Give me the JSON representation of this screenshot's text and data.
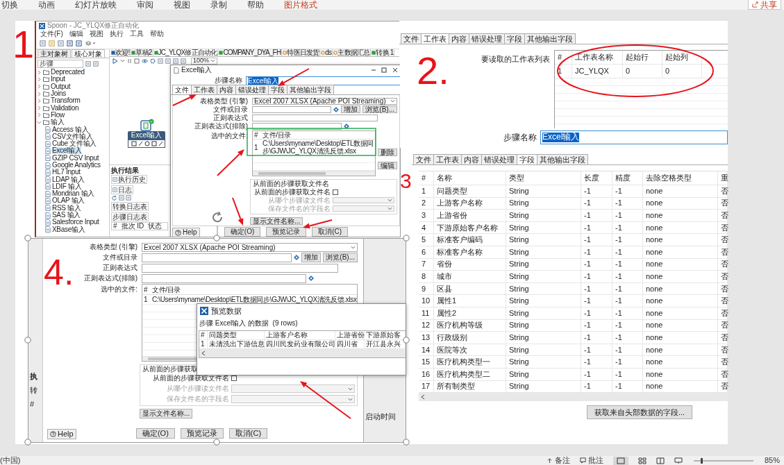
{
  "ribbon": {
    "tabs": [
      {
        "label": "切换",
        "selected": false
      },
      {
        "label": "动画",
        "selected": false
      },
      {
        "label": "幻灯片放映",
        "selected": false
      },
      {
        "label": "审阅",
        "selected": false
      },
      {
        "label": "视图",
        "selected": false
      },
      {
        "label": "录制",
        "selected": false
      },
      {
        "label": "帮助",
        "selected": false
      },
      {
        "label": "图片格式",
        "selected": true
      }
    ],
    "share": "共享"
  },
  "spoon": {
    "title": "Spoon - JC_YLQX修正自动化",
    "menu": [
      "文件(F)",
      "编辑",
      "视图",
      "执行",
      "工具",
      "帮助"
    ],
    "panel_tabs": [
      {
        "label": "主对象树",
        "selected": false
      },
      {
        "label": "核心对象",
        "selected": true
      }
    ],
    "search_placeholder": "步骤",
    "tree": [
      {
        "label": "Deprecated",
        "expanded": false
      },
      {
        "label": "Input",
        "expanded": false
      },
      {
        "label": "Output",
        "expanded": false
      },
      {
        "label": "Joins",
        "expanded": false
      },
      {
        "label": "Transform",
        "expanded": false
      },
      {
        "label": "Validation",
        "expanded": false
      },
      {
        "label": "Flow",
        "expanded": false
      },
      {
        "label": "输入",
        "expanded": true,
        "children": [
          {
            "label": "Access 输入",
            "selected": false
          },
          {
            "label": "CSV文件输入",
            "selected": false
          },
          {
            "label": "Cube 文件输入",
            "selected": false
          },
          {
            "label": "Excel输入",
            "selected": true
          },
          {
            "label": "GZIP CSV Input",
            "selected": false
          },
          {
            "label": "Google Analytics",
            "selected": false
          },
          {
            "label": "HL7 Input",
            "selected": false
          },
          {
            "label": "LDAP 输入",
            "selected": false
          },
          {
            "label": "LDIF 输入",
            "selected": false
          },
          {
            "label": "Mondrian 输入",
            "selected": false
          },
          {
            "label": "OLAP 输入",
            "selected": false
          },
          {
            "label": "RSS 输入",
            "selected": false
          },
          {
            "label": "SAS 输入",
            "selected": false
          },
          {
            "label": "Salesforce Input",
            "selected": false
          },
          {
            "label": "XBase输入",
            "selected": false
          }
        ]
      }
    ],
    "file_tabs": [
      {
        "label": "欢迎!",
        "kind": "welcome",
        "selected": false
      },
      {
        "label": "草稿2",
        "kind": "transformation",
        "selected": false
      },
      {
        "label": "JC_YLQX修正自动化",
        "kind": "transformation",
        "selected": true
      },
      {
        "label": "COMPANY_DYA_FH",
        "kind": "transformation",
        "selected": false
      },
      {
        "label": "特医日发货",
        "kind": "job",
        "selected": false
      },
      {
        "label": "ds",
        "kind": "job",
        "selected": false
      },
      {
        "label": "主数据汇总",
        "kind": "job",
        "selected": false
      },
      {
        "label": "转换 1",
        "kind": "transformation",
        "selected": false
      }
    ],
    "zoom": "100%",
    "node": "Excel输入",
    "results": {
      "title": "执行结果",
      "tabs": [
        "执行历史",
        "日志"
      ],
      "subtabs": [
        "转换日志表",
        "步骤日志表"
      ],
      "columns": [
        "#",
        "批次 ID",
        "状态"
      ]
    },
    "dialog": {
      "title": "Excel输入",
      "step_label": "步骤名称",
      "step_value": "Excel输入",
      "tabs": [
        {
          "label": "文件",
          "selected": true
        },
        {
          "label": "工作表",
          "selected": false
        },
        {
          "label": "内容",
          "selected": false
        },
        {
          "label": "错误处理",
          "selected": false
        },
        {
          "label": "字段",
          "selected": false
        },
        {
          "label": "其他输出字段",
          "selected": false
        }
      ],
      "form": {
        "engine_label": "表格类型 (引擎)",
        "engine_value": "Excel 2007 XLSX (Apache POI Streaming)",
        "file_label": "文件或目录",
        "add": "增加",
        "browse": "浏览(B)...",
        "regex_label": "正则表达式",
        "exclude_label": "正则表达式(排除)",
        "selected_label": "选中的文件:",
        "files_columns": [
          "#",
          "文件/目录"
        ],
        "files_rows": [
          [
            "1",
            "C:\\Users\\myname\\Desktop\\ETL数据同步\\GJW\\JC_YLQX清洗反馈.xlsx"
          ]
        ],
        "side_buttons": [
          "删除",
          "编辑"
        ],
        "group_title": "从前面的步骤获取文件名",
        "accept_label": "从前面的步骤获取文件名",
        "accept_checked": false,
        "step_label": "从哪个步骤读文件名",
        "field_label": "保存文件名的字段名",
        "show_button": "显示文件名称..."
      },
      "buttons": [
        "确定(O)",
        "预览记录",
        "取消(C)"
      ],
      "help": "Help"
    }
  },
  "sheets_panel": {
    "tabs": [
      {
        "label": "文件",
        "selected": false
      },
      {
        "label": "工作表",
        "selected": true
      },
      {
        "label": "内容",
        "selected": false
      },
      {
        "label": "错误处理",
        "selected": false
      },
      {
        "label": "字段",
        "selected": false
      },
      {
        "label": "其他输出字段",
        "selected": false
      }
    ],
    "list_label": "要读取的工作表列表",
    "columns": [
      "#",
      "工作表名称",
      "起始行",
      "起始列"
    ],
    "rows": [
      [
        "1",
        "JC_YLQX",
        "0",
        "0"
      ]
    ],
    "step_label": "步骤名称",
    "step_value": "Excel输入"
  },
  "fields_panel": {
    "tabs": [
      {
        "label": "文件",
        "selected": false
      },
      {
        "label": "工作表",
        "selected": false
      },
      {
        "label": "内容",
        "selected": false
      },
      {
        "label": "错误处理",
        "selected": false
      },
      {
        "label": "字段",
        "selected": true
      },
      {
        "label": "其他输出字段",
        "selected": false
      }
    ],
    "columns": [
      "#",
      "名称",
      "类型",
      "长度",
      "精度",
      "去除空格类型",
      "重"
    ],
    "rows": [
      [
        "1",
        "问题类型",
        "String",
        "-1",
        "-1",
        "none",
        "否"
      ],
      [
        "2",
        "上游客户名称",
        "String",
        "-1",
        "-1",
        "none",
        "否"
      ],
      [
        "3",
        "上游省份",
        "String",
        "-1",
        "-1",
        "none",
        "否"
      ],
      [
        "4",
        "下游原始客户名称",
        "String",
        "-1",
        "-1",
        "none",
        "否"
      ],
      [
        "5",
        "标准客户编码",
        "String",
        "-1",
        "-1",
        "none",
        "否"
      ],
      [
        "6",
        "标准客户名称",
        "String",
        "-1",
        "-1",
        "none",
        "否"
      ],
      [
        "7",
        "省份",
        "String",
        "-1",
        "-1",
        "none",
        "否"
      ],
      [
        "8",
        "城市",
        "String",
        "-1",
        "-1",
        "none",
        "否"
      ],
      [
        "9",
        "区县",
        "String",
        "-1",
        "-1",
        "none",
        "否"
      ],
      [
        "10",
        "属性1",
        "String",
        "-1",
        "-1",
        "none",
        "否"
      ],
      [
        "11",
        "属性2",
        "String",
        "-1",
        "-1",
        "none",
        "否"
      ],
      [
        "12",
        "医疗机构等级",
        "String",
        "-1",
        "-1",
        "none",
        "否"
      ],
      [
        "13",
        "行政级别",
        "String",
        "-1",
        "-1",
        "none",
        "否"
      ],
      [
        "14",
        "医院等次",
        "String",
        "-1",
        "-1",
        "none",
        "否"
      ],
      [
        "15",
        "医疗机构类型一",
        "String",
        "-1",
        "-1",
        "none",
        "否"
      ],
      [
        "16",
        "医疗机构类型二",
        "String",
        "-1",
        "-1",
        "none",
        "否"
      ],
      [
        "17",
        "所有制类型",
        "String",
        "-1",
        "-1",
        "none",
        "否"
      ]
    ],
    "button": "获取来自头部数据的字段..."
  },
  "zoomed_dialog": {
    "background_left": [
      "执",
      "转",
      "#"
    ],
    "background_right": "启动时间",
    "form": {
      "engine_label": "表格类型 (引擎)",
      "engine_value": "Excel 2007 XLSX (Apache POI Streaming)",
      "file_label": "文件或目录",
      "add": "增加",
      "browse": "浏览(B)...",
      "regex_label": "正则表达式",
      "exclude_label": "正则表达式(排除)",
      "selected_label": "选中的文件:",
      "files_columns": [
        "#",
        "文件/目录"
      ],
      "files_rows": [
        [
          "1",
          "C:\\Users\\myname\\Desktop\\ETL数据同步\\GJW\\JC_YLQX清洗反馈.xlsx"
        ]
      ],
      "group_title": "从前面的步骤获取",
      "accept_label": "从前面的步骤获取文件名",
      "accept_checked": false,
      "step_label": "从哪个步骤读文件名",
      "field_label": "保存文件名的字段名",
      "show_button": "显示文件名称..."
    },
    "buttons": [
      "确定(O)",
      "预览记录",
      "取消(C)"
    ],
    "help": "Help",
    "preview": {
      "title": "预览数据",
      "caption": "步骤 Excel输入 的数据  (9 rows)",
      "columns": [
        "#",
        "问题类型",
        "上游客户名称",
        "上游省份",
        "下游原始客"
      ],
      "rows": [
        [
          "1",
          "未清洗出下游信息",
          "四川民发药业有限公司",
          "四川省",
          "开江县永兴"
        ]
      ]
    }
  },
  "annotations": [
    "1",
    "2.",
    "3",
    "4."
  ],
  "status_bar": {
    "language": "(中国)",
    "notes": "备注",
    "comments": "批注",
    "zoom": "85%"
  }
}
